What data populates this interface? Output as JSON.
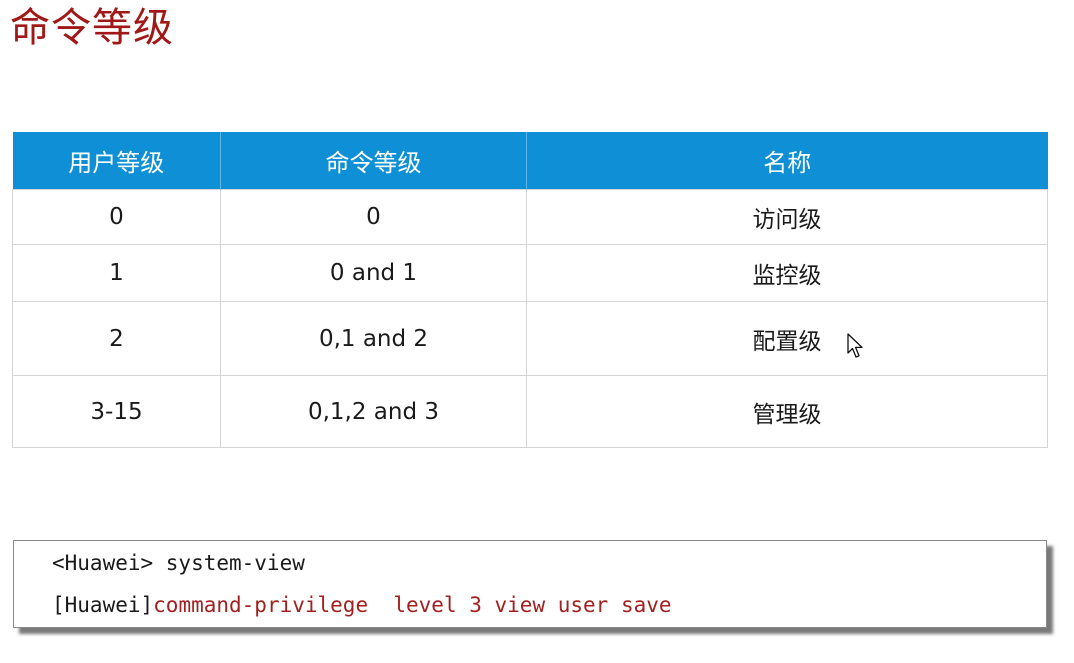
{
  "title": "命令等级",
  "table": {
    "headers": [
      "用户等级",
      "命令等级",
      "名称"
    ],
    "rows": [
      [
        "0",
        "0",
        "访问级"
      ],
      [
        "1",
        "0 and 1",
        "监控级"
      ],
      [
        "2",
        "0,1 and 2",
        "配置级"
      ],
      [
        "3-15",
        "0,1,2 and 3",
        "管理级"
      ]
    ]
  },
  "code": {
    "line1": "<Huawei> system-view",
    "line2_prompt": "[Huawei]",
    "line2_command": "command-privilege  level 3 view user save"
  },
  "icons": {
    "cursor": "mouse-pointer-icon"
  },
  "colors": {
    "title": "#a01818",
    "header_bg": "#0f8fd6",
    "command": "#a32020"
  }
}
